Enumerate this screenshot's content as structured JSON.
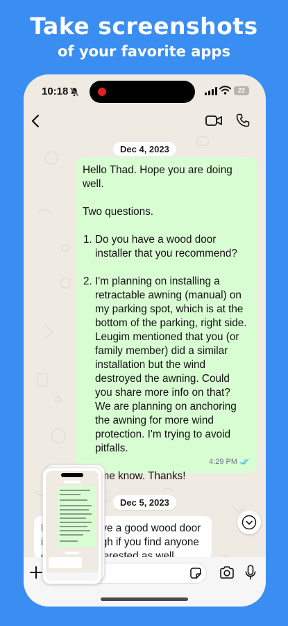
{
  "promo": {
    "headline": "Take screenshots",
    "subheadline": "of your favorite apps"
  },
  "status_bar": {
    "time": "10:18",
    "battery": "22"
  },
  "chat": {
    "date_1": "Dec 4, 2023",
    "message_1": {
      "greeting": "Hello Thad. Hope you are doing well.",
      "intro": "Two questions.",
      "q1": "Do you have a wood door installer that you recommend?",
      "q2": "I'm planning on installing a retractable awning (manual) on my parking spot, which is at the bottom of the parking, right side. Leugim mentioned that you (or family member) did a similar installation but the wind destroyed the awning. Could you share more info on that? We are planning on anchoring the awning for more wind protection. I'm trying to avoid pitfalls.",
      "closing": "Let me know. Thanks!",
      "time": "4:29 PM"
    },
    "date_2": "Dec 5, 2023",
    "message_2": {
      "text": "Hi Thad. I have a good wood door installer though if you find anyone else I'd be interested as well"
    }
  },
  "icons": {
    "back": "chevron-left-icon",
    "video": "video-camera-icon",
    "call": "phone-icon",
    "silent": "bell-slash-icon",
    "scroll": "chevron-down-icon",
    "attach": "plus-icon",
    "sticker": "sticker-icon",
    "camera": "camera-icon",
    "mic": "microphone-icon",
    "read": "double-check-icon"
  },
  "colors": {
    "background": "#3a8ef2",
    "chat_wallpaper": "#efeae2",
    "outgoing_bubble": "#d9fdd3",
    "incoming_bubble": "#ffffff",
    "read_receipt": "#53bdeb",
    "recording_dot": "#e0202a"
  }
}
